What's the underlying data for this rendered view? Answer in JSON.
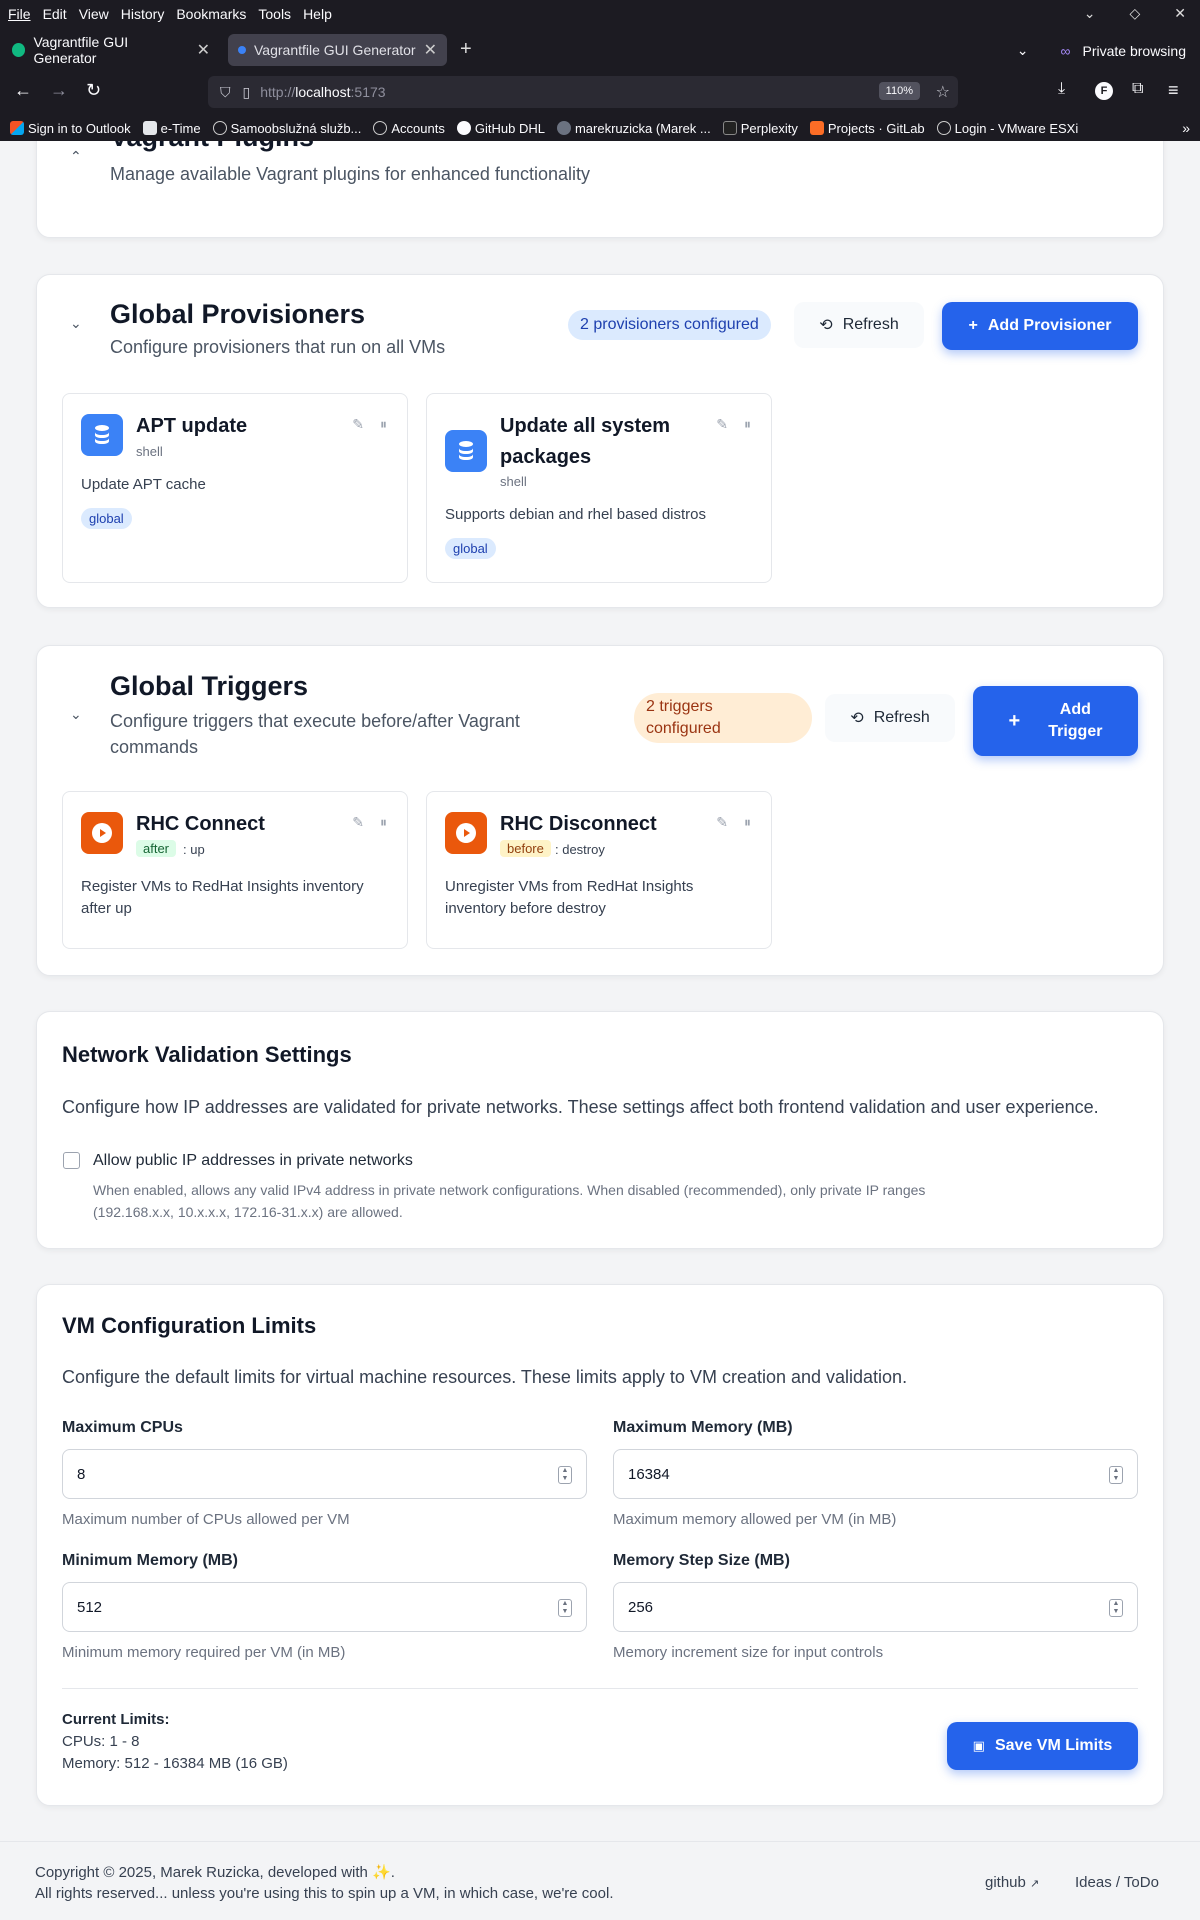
{
  "browser": {
    "menu": [
      "File",
      "Edit",
      "View",
      "History",
      "Bookmarks",
      "Tools",
      "Help"
    ],
    "tabs": [
      {
        "title": "Vagrantfile GUI Generator"
      },
      {
        "title": "Vagrantfile GUI Generator"
      }
    ],
    "private_label": "Private browsing",
    "url_prefix": "http://",
    "url_host": "localhost",
    "url_rest": ":5173",
    "zoom": "110%",
    "bookmarks": [
      "Sign in to Outlook",
      "e-Time",
      "Samoobslužná služb...",
      "Accounts",
      "GitHub DHL",
      "marekruzicka (Marek ...",
      "Perplexity",
      "Projects · GitLab",
      "Login - VMware ESXi"
    ]
  },
  "plugins": {
    "title": "Vagrant Plugins",
    "subtitle": "Manage available Vagrant plugins for enhanced functionality"
  },
  "provisioners": {
    "title": "Global Provisioners",
    "subtitle": "Configure provisioners that run on all VMs",
    "count_label": "2 provisioners configured",
    "refresh_label": "Refresh",
    "add_label": "Add Provisioner",
    "items": [
      {
        "name": "APT update",
        "type": "shell",
        "description": "Update APT cache",
        "tag": "global"
      },
      {
        "name_line1": "Update all system",
        "name_line2": "packages",
        "type": "shell",
        "description": "Supports debian and rhel based distros",
        "tag": "global"
      }
    ]
  },
  "triggers": {
    "title": "Global Triggers",
    "subtitle_line1": "Configure triggers that execute before/after Vagrant",
    "subtitle_line2": "commands",
    "count_line1": "2 triggers",
    "count_line2": "configured",
    "refresh_label": "Refresh",
    "add_line1": "Add",
    "add_line2": "Trigger",
    "items": [
      {
        "name": "RHC Connect",
        "timing": "after",
        "command": ": up",
        "desc_line1": "Register VMs to RedHat Insights inventory",
        "desc_line2": "after up"
      },
      {
        "name": "RHC Disconnect",
        "timing": "before",
        "command": ": destroy",
        "desc_line1": "Unregister VMs from RedHat Insights",
        "desc_line2": "inventory before destroy"
      }
    ]
  },
  "network": {
    "title": "Network Validation Settings",
    "description": "Configure how IP addresses are validated for private networks. These settings affect both frontend validation and user experience.",
    "checkbox_label": "Allow public IP addresses in private networks",
    "checkbox_checked": false,
    "help_line1": "When enabled, allows any valid IPv4 address in private network configurations. When disabled (recommended), only private IP ranges",
    "help_line2": "(192.168.x.x, 10.x.x.x, 172.16-31.x.x) are allowed."
  },
  "vm_limits": {
    "title": "VM Configuration Limits",
    "description": "Configure the default limits for virtual machine resources. These limits apply to VM creation and validation.",
    "fields": [
      {
        "label": "Maximum CPUs",
        "value": "8",
        "hint": "Maximum number of CPUs allowed per VM"
      },
      {
        "label": "Maximum Memory (MB)",
        "value": "16384",
        "hint": "Maximum memory allowed per VM (in MB)"
      },
      {
        "label": "Minimum Memory (MB)",
        "value": "512",
        "hint": "Minimum memory required per VM (in MB)"
      },
      {
        "label": "Memory Step Size (MB)",
        "value": "256",
        "hint": "Memory increment size for input controls"
      }
    ],
    "current_title": "Current Limits:",
    "current_cpus": "CPUs: 1 - 8",
    "current_memory": "Memory: 512 - 16384 MB (16 GB)",
    "save_label": "Save VM Limits"
  },
  "footer": {
    "copyright": "Copyright © 2025, Marek Ruzicka, developed with ✨.",
    "rights": "All rights reserved... unless you're using this to spin up a VM, in which case, we're cool.",
    "github": "github",
    "ideas": "Ideas / ToDo"
  },
  "colors": {
    "primary": "#2563eb",
    "provisioner_icon": "#3b82f6",
    "trigger_icon": "#ea580c",
    "after_badge": "#dcfce7",
    "before_badge": "#fef3c7"
  }
}
